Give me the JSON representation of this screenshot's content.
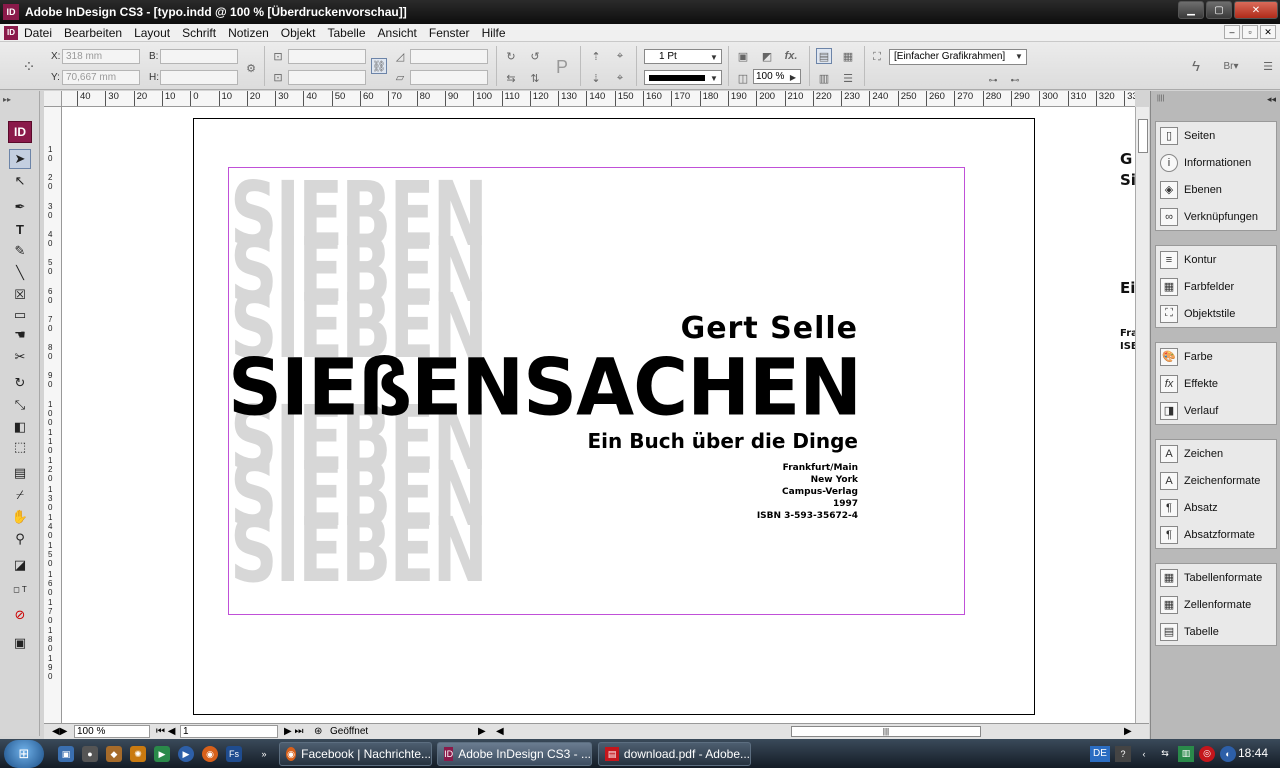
{
  "window": {
    "title": "Adobe InDesign CS3 - [typo.indd @ 100 % [Überdruckenvorschau]]",
    "app_logo": "ID"
  },
  "menu": {
    "items": [
      "Datei",
      "Bearbeiten",
      "Layout",
      "Schrift",
      "Notizen",
      "Objekt",
      "Tabelle",
      "Ansicht",
      "Fenster",
      "Hilfe"
    ]
  },
  "control": {
    "x_label": "X:",
    "x_value": "318 mm",
    "y_label": "Y:",
    "y_value": "70,667 mm",
    "w_label": "B:",
    "h_label": "H:",
    "stroke_weight": "1 Pt",
    "opacity": "100 %",
    "object_style": "[Einfacher Grafikrahmen]"
  },
  "ruler": {
    "h_labels": [
      "40",
      "30",
      "20",
      "10",
      "0",
      "10",
      "20",
      "30",
      "40",
      "50",
      "60",
      "70",
      "80",
      "90",
      "100",
      "110",
      "120",
      "130",
      "140",
      "150",
      "160",
      "170",
      "180",
      "190",
      "200",
      "210",
      "220",
      "230",
      "240",
      "250",
      "260",
      "270",
      "280",
      "290",
      "300",
      "310",
      "320",
      "33"
    ],
    "v_labels": [
      "1 0",
      "2 0",
      "3 0",
      "4 0",
      "5 0",
      "6 0",
      "7 0",
      "8 0",
      "9 0",
      "1 0 0",
      "1 1 0",
      "1 2 0",
      "1 3 0",
      "1 4 0",
      "1 5 0",
      "1 6 0",
      "1 7 0",
      "1 8 0",
      "1 9 0"
    ]
  },
  "document": {
    "ghost_word": "SIEBEN",
    "author": "Gert Selle",
    "title": "SIEßENSACHEN",
    "subtitle": "Ein Buch über die Dinge",
    "imprint": [
      "Frankfurt/Main",
      "New York",
      "Campus-Verlag",
      "1997",
      "ISBN 3-593-35672-4"
    ],
    "next_page_peek": [
      "G",
      "Sie",
      "Ein",
      "Fra",
      "ISB"
    ]
  },
  "status": {
    "zoom": "100 %",
    "page": "1",
    "state": "Geöffnet"
  },
  "panels": {
    "group1": [
      "Seiten",
      "Informationen",
      "Ebenen",
      "Verknüpfungen"
    ],
    "group2": [
      "Kontur",
      "Farbfelder",
      "Objektstile"
    ],
    "group3": [
      "Farbe",
      "Effekte",
      "Verlauf"
    ],
    "group4": [
      "Zeichen",
      "Zeichenformate",
      "Absatz",
      "Absatzformate"
    ],
    "group5": [
      "Tabellenformate",
      "Zellenformate",
      "Tabelle"
    ]
  },
  "taskbar": {
    "tasks": [
      "Facebook | Nachrichte...",
      "Adobe InDesign CS3 - ...",
      "download.pdf - Adobe..."
    ],
    "language": "DE",
    "clock": "18:44"
  }
}
